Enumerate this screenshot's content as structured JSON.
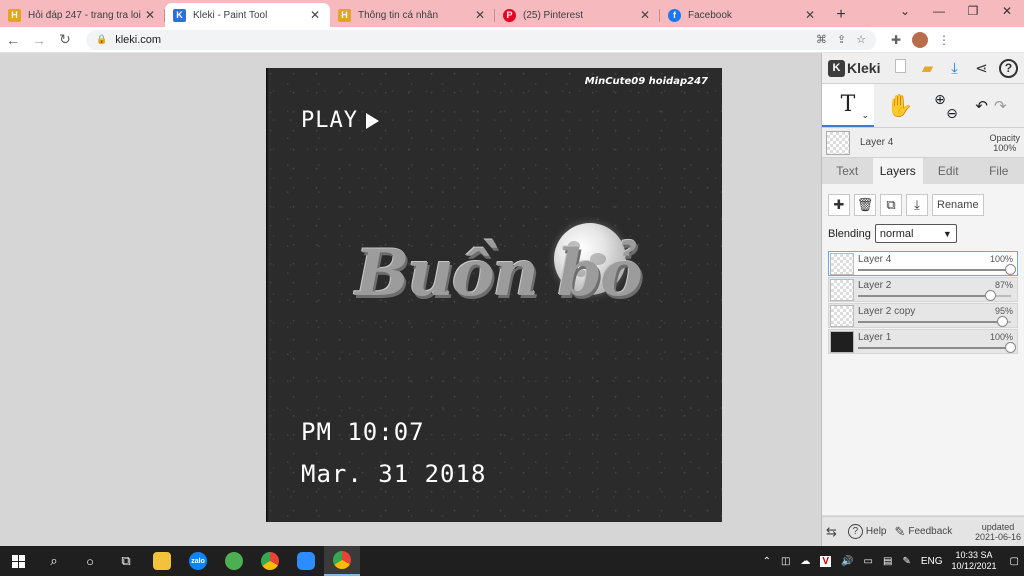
{
  "browser": {
    "tabs": [
      {
        "title": "Hỏi đáp 247 - trang tra loi",
        "favicon_color": "#e6a323",
        "favicon_glyph": "H"
      },
      {
        "title": "Kleki - Paint Tool",
        "favicon_color": "#3d3d3d",
        "favicon_glyph": "K"
      },
      {
        "title": "Thông tin cá nhân",
        "favicon_color": "#e6a323",
        "favicon_glyph": "H"
      },
      {
        "title": "(25) Pinterest",
        "favicon_color": "#e60023",
        "favicon_glyph": "P"
      },
      {
        "title": "Facebook",
        "favicon_color": "#1877f2",
        "favicon_glyph": "f"
      }
    ],
    "active_tab_index": 1,
    "url": "kleki.com",
    "accent_color": "#f6b9bd"
  },
  "canvas": {
    "credit": "MinCute09 hoidap247",
    "play_label": "PLAY",
    "script_text": "Buồn bỏ",
    "time": "PM 10:07",
    "date": "Mar. 31 2018"
  },
  "kleki": {
    "brand": "Kleki",
    "current_layer": "Layer 4",
    "opacity_label": "Opacity",
    "opacity_value": "100%",
    "tabs": [
      "Text",
      "Layers",
      "Edit",
      "File"
    ],
    "active_tab": "Layers",
    "rename_label": "Rename",
    "blending_label": "Blending",
    "blending_value": "normal",
    "layers": [
      {
        "name": "Layer 4",
        "opacity": "100%",
        "value": 1.0,
        "thumb": "transparent"
      },
      {
        "name": "Layer 2",
        "opacity": "87%",
        "value": 0.87,
        "thumb": "transparent"
      },
      {
        "name": "Layer 2 copy",
        "opacity": "95%",
        "value": 0.95,
        "thumb": "transparent"
      },
      {
        "name": "Layer 1",
        "opacity": "100%",
        "value": 1.0,
        "thumb": "dark"
      }
    ],
    "footer": {
      "help": "Help",
      "feedback": "Feedback",
      "updated_label": "updated",
      "updated_date": "2021-06-16"
    }
  },
  "taskbar": {
    "language": "ENG",
    "time": "10:33 SA",
    "date": "10/12/2021"
  }
}
